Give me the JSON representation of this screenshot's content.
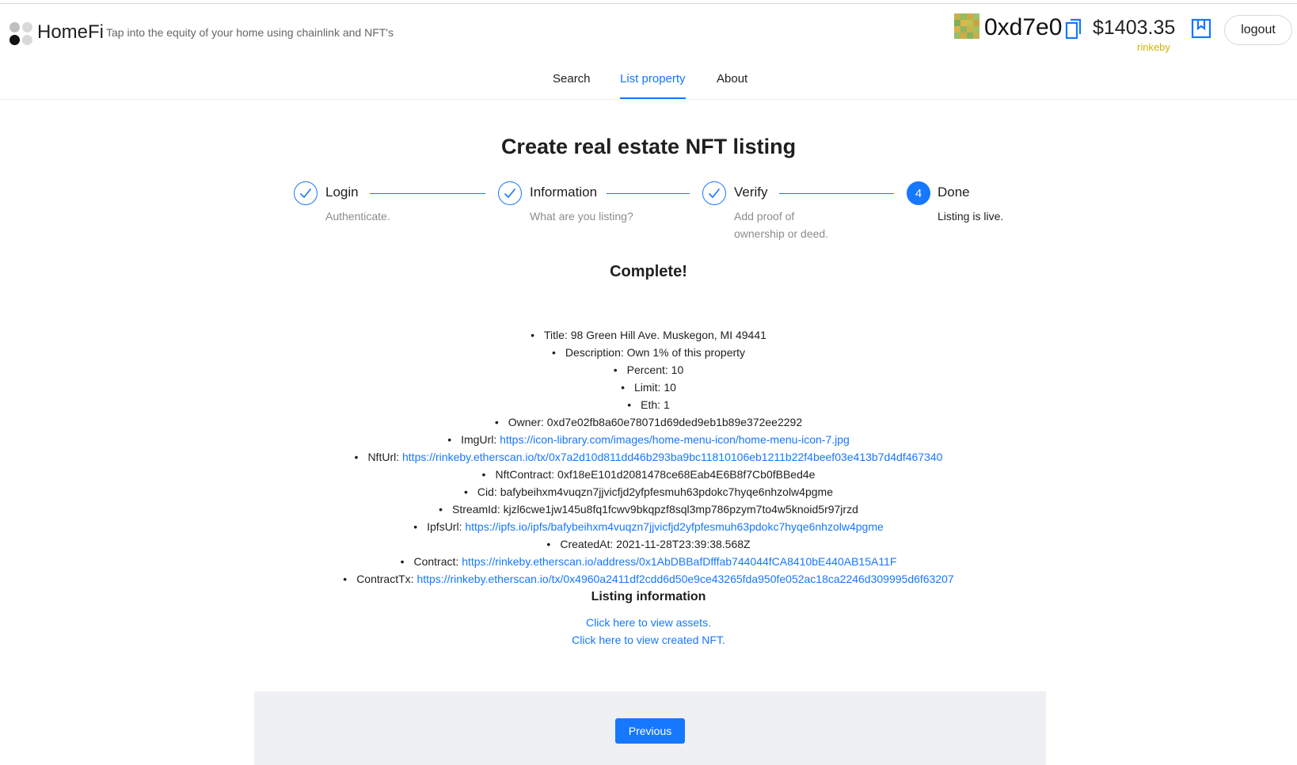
{
  "header": {
    "brand": "HomeFi",
    "tagline": "Tap into the equity of your home using chainlink and NFT's",
    "address": "0xd7e0",
    "balance": "$1403.35",
    "network": "rinkeby",
    "logout_label": "logout",
    "accent_color": "#1677ff",
    "network_color": "#d4b106"
  },
  "nav": {
    "items": [
      {
        "label": "Search"
      },
      {
        "label": "List property",
        "active": true
      },
      {
        "label": "About"
      }
    ]
  },
  "main": {
    "title": "Create real estate NFT listing",
    "steps": [
      {
        "title": "Login",
        "description": "Authenticate.",
        "status": "finished",
        "icon": "check-icon"
      },
      {
        "title": "Information",
        "description": "What are you listing?",
        "status": "finished",
        "icon": "check-icon"
      },
      {
        "title": "Verify",
        "description_line1": "Add proof of",
        "description_line2": "ownership or deed.",
        "status": "finished",
        "icon": "check-icon"
      },
      {
        "title": "Done",
        "description": "Listing is live.",
        "status": "current",
        "number": "4"
      }
    ],
    "result_heading": "Complete!",
    "details": [
      {
        "key": "Title:",
        "value": "98 Green Hill Ave. Muskegon, MI 49441"
      },
      {
        "key": "Description:",
        "value": "Own 1% of this property"
      },
      {
        "key": "Percent:",
        "value": "10"
      },
      {
        "key": "Limit:",
        "value": "10"
      },
      {
        "key": "Eth:",
        "value": "1"
      },
      {
        "key": "Owner:",
        "value": "0xd7e02fb8a60e78071d69ded9eb1b89e372ee2292"
      },
      {
        "key": "ImgUrl:",
        "link": "https://icon-library.com/images/home-menu-icon/home-menu-icon-7.jpg"
      },
      {
        "key": "NftUrl:",
        "link": "https://rinkeby.etherscan.io/tx/0x7a2d10d811dd46b293ba9bc11810106eb1211b22f4beef03e413b7d4df467340"
      },
      {
        "key": "NftContract:",
        "value": "0xf18eE101d2081478ce68Eab4E6B8f7Cb0fBBed4e"
      },
      {
        "key": "Cid:",
        "value": "bafybeihxm4vuqzn7jjvicfjd2yfpfesmuh63pdokc7hyqe6nhzolw4pgme"
      },
      {
        "key": "StreamId:",
        "value": "kjzl6cwe1jw145u8fq1fcwv9bkqpzf8sql3mp786pzym7to4w5knoid5r97jrzd"
      },
      {
        "key": "IpfsUrl:",
        "link": "https://ipfs.io/ipfs/bafybeihxm4vuqzn7jjvicfjd2yfpfesmuh63pdokc7hyqe6nhzolw4pgme"
      },
      {
        "key": "CreatedAt:",
        "value": "2021-11-28T23:39:38.568Z"
      },
      {
        "key": "Contract:",
        "link": "https://rinkeby.etherscan.io/address/0x1AbDBBafDfffab744044fCA8410bE440AB15A11F"
      },
      {
        "key": "ContractTx:",
        "link": "https://rinkeby.etherscan.io/tx/0x4960a2411df2cdd6d50e9ce43265fda950fe052ac18ca2246d309995d6f63207"
      }
    ],
    "listing_heading": "Listing information",
    "view_assets_link": "Click here to view assets.",
    "view_nft_link": "Click here to view created NFT."
  },
  "footer": {
    "previous_label": "Previous"
  }
}
